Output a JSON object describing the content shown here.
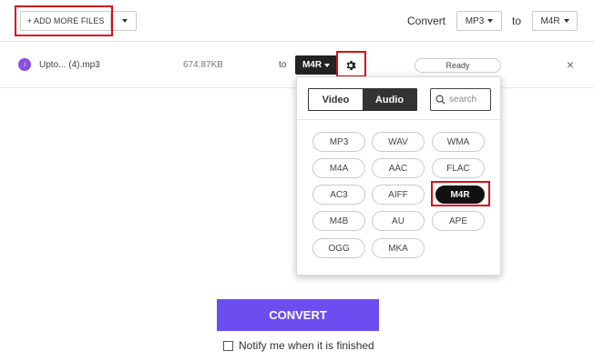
{
  "toolbar": {
    "add_files_label": "+ ADD MORE FILES",
    "convert_label": "Convert",
    "from_format": "MP3",
    "to_label": "to",
    "to_format": "M4R"
  },
  "file": {
    "name": "Upto... (4).mp3",
    "size": "674.87KB",
    "to_label": "to",
    "target_format": "M4R",
    "status": "Ready",
    "close_glyph": "×"
  },
  "format_panel": {
    "tabs": [
      {
        "label": "Video",
        "active": false
      },
      {
        "label": "Audio",
        "active": true
      }
    ],
    "search_placeholder": "search",
    "formats": [
      {
        "label": "MP3"
      },
      {
        "label": "WAV"
      },
      {
        "label": "WMA"
      },
      {
        "label": "M4A"
      },
      {
        "label": "AAC"
      },
      {
        "label": "FLAC"
      },
      {
        "label": "AC3"
      },
      {
        "label": "AIFF"
      },
      {
        "label": "M4R",
        "selected": true
      },
      {
        "label": "M4B"
      },
      {
        "label": "AU"
      },
      {
        "label": "APE"
      },
      {
        "label": "OGG"
      },
      {
        "label": "MKA"
      }
    ]
  },
  "main": {
    "convert_button": "CONVERT",
    "notify_label": "Notify me when it is finished"
  },
  "colors": {
    "accent": "#6c4df0",
    "highlight": "#d40f17",
    "file_icon": "#8a4fe3"
  }
}
